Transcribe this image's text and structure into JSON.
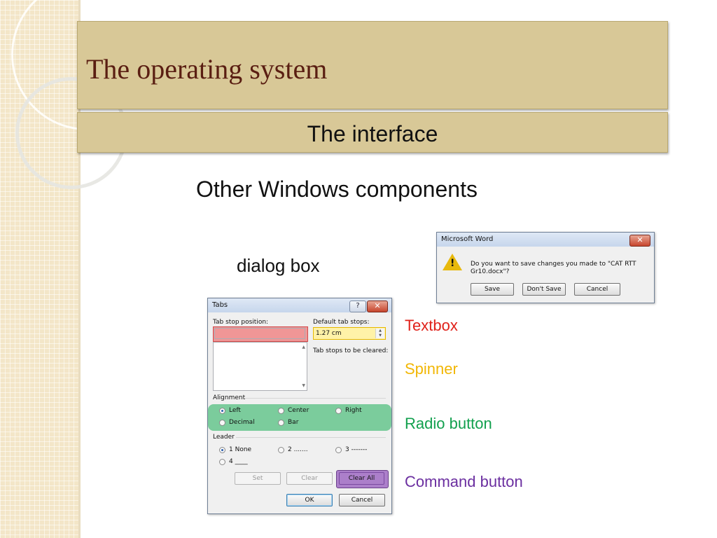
{
  "slide": {
    "title": "The operating system",
    "subtitle": "The interface",
    "heading": "Other Windows components",
    "dialog_caption": "dialog box"
  },
  "word_dialog": {
    "title": "Microsoft Word",
    "close_glyph": "✕",
    "icon": "warning-icon",
    "warn_glyph": "!",
    "message": "Do you want to save changes you made to \"CAT RTT Gr10.docx\"?",
    "buttons": {
      "save": "Save",
      "dont_save": "Don't Save",
      "cancel": "Cancel"
    }
  },
  "tabs_dialog": {
    "title": "Tabs",
    "help_glyph": "?",
    "close_glyph": "✕",
    "tab_stop_position_label": "Tab stop position:",
    "tab_stop_position_value": "",
    "default_tab_stops_label": "Default tab stops:",
    "default_tab_stops_value": "1.27 cm",
    "spin_up": "▲",
    "spin_down": "▼",
    "scroll_up": "▲",
    "scroll_down": "▼",
    "tab_stops_cleared_label": "Tab stops to be cleared:",
    "alignment_label": "Alignment",
    "alignment_options": [
      "Left",
      "Center",
      "Right",
      "Decimal",
      "Bar"
    ],
    "alignment_selected": "Left",
    "leader_label": "Leader",
    "leader_options": [
      "1 None",
      "2 .......",
      "3 -------",
      "4 ____"
    ],
    "leader_selected": "1 None",
    "buttons": {
      "set": "Set",
      "clear": "Clear",
      "clear_all": "Clear All",
      "ok": "OK",
      "cancel": "Cancel"
    }
  },
  "legend": {
    "textbox": "Textbox",
    "spinner": "Spinner",
    "radio_button": "Radio button",
    "command_button": "Command button"
  },
  "colors": {
    "textbox": "#e0211a",
    "spinner": "#f2b705",
    "radio_button": "#12a04e",
    "command_button": "#6b2fa0",
    "title_text": "#5a1e12",
    "title_bar": "#d8c897"
  }
}
